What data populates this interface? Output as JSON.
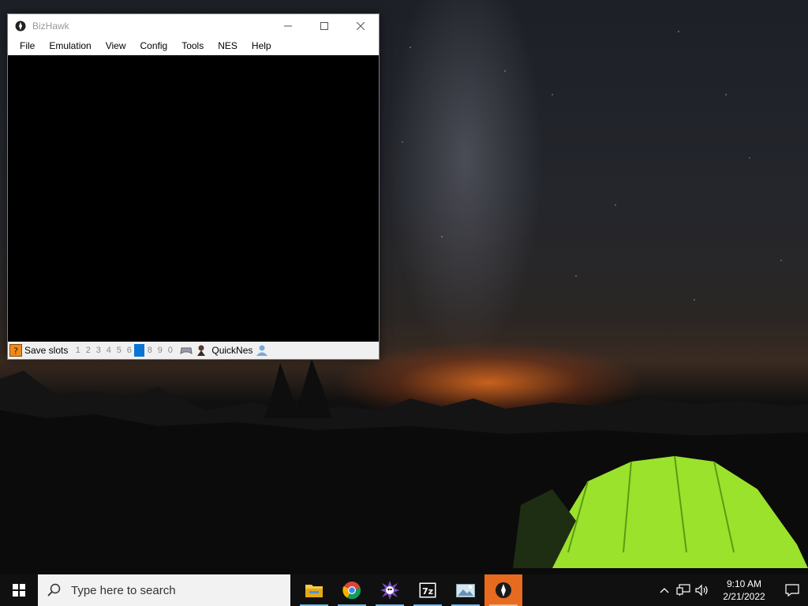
{
  "window": {
    "title": "BizHawk",
    "menu": [
      "File",
      "Emulation",
      "View",
      "Config",
      "Tools",
      "NES",
      "Help"
    ],
    "statusbar": {
      "save_slots_label": "Save slots",
      "slots": [
        "1",
        "2",
        "3",
        "4",
        "5",
        "6",
        "7",
        "8",
        "9",
        "0"
      ],
      "active_slot": "7",
      "core_name": "QuickNes"
    }
  },
  "taskbar": {
    "search_placeholder": "Type here to search",
    "apps": [
      {
        "name": "File Explorer",
        "icon": "folder-icon",
        "running": true
      },
      {
        "name": "Google Chrome",
        "icon": "chrome-icon",
        "running": true
      },
      {
        "name": "Emulator launcher",
        "icon": "star-burst-icon",
        "running": true
      },
      {
        "name": "7-Zip",
        "icon": "7z-icon",
        "running": true
      },
      {
        "name": "Image viewer",
        "icon": "picture-icon",
        "running": true
      },
      {
        "name": "BizHawk",
        "icon": "bizhawk-icon",
        "running": true,
        "active": true
      }
    ],
    "clock": {
      "time": "9:10 AM",
      "date": "2/21/2022"
    }
  },
  "colors": {
    "taskbar": "#101010",
    "active_app": "#e66b1f",
    "active_slot": "#0a74d6",
    "tent": "#9be22c"
  }
}
